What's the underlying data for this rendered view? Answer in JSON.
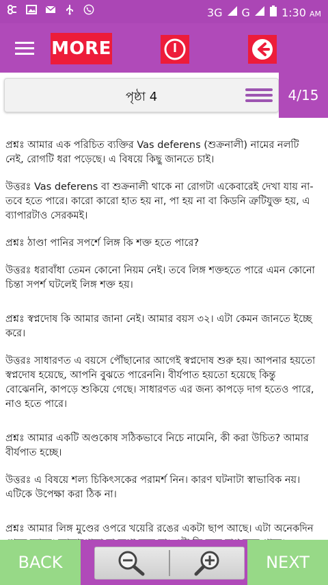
{
  "status_bar": {
    "network": "3G",
    "time": "1:30",
    "ampm": "AM"
  },
  "app_bar": {
    "more_label": "MORE"
  },
  "page_bar": {
    "title": "পৃষ্ঠা 4",
    "count": "4/15"
  },
  "content": {
    "paragraphs": [
      "প্রশ্নঃ আমার এক পরিচিত ব্যক্তির Vas deferens (শুক্রনালী) নামের নলটি নেই, রোগটি ধরা পড়েছে। এ বিষয়ে কিছু জানতে চাই।",
      "উত্তরঃ Vas deferens বা শুক্রনালী থাকে না রোগটা একেবারেই দেখা যায় না- তবে হতে পারে। কারো কারো হাত হয় না, পা হয় না বা কিডনি ত্রুটিযুক্ত হয়, এ ব্যাপারটাও সেরকমই।",
      "প্রশ্নঃ ঠাণ্ডা পানির সপর্শে লিঙ্গ কি শক্ত হতে পারে?",
      "উত্তরঃ ধরাবাঁধা তেমন কোনো নিয়ম নেই। তবে লিঙ্গ শক্তহতে পারে এমন কোনো চিন্তা সপর্শ ঘটলেই লিঙ্গ শক্ত হয়।",
      "প্রশ্নঃ স্বপ্নদোষ কি আমার জানা নেই। আমার বয়স ৩২। এটা কেমন জানতে ইচ্ছে করে।",
      "উত্তরঃ সাধারণত এ বয়সে পৌঁছানোর আগেই স্বপ্নদোষ শুরু হয়। আপনার হয়তো স্বপ্নদোষ হয়েছে, আপনি বুঝতে পারেননি। বীর্যপাত হয়তো হয়েছে কিন্তু বোঝেননি, কাপড়ে শুকিয়ে গেছে। সাধারণত এর জন্য কাপড়ে দাগ হতেও পারে, নাও হতে পারে।",
      "প্রশ্নঃ আমার একটি অণ্ডকোষ সঠিকভাবে নিচে নামেনি, কী করা উচিত? আমার বীর্যপাত হচ্ছে।",
      "উত্তরঃ এ বিষয়ে শল্য চিকিৎসকের পরামর্শ নিন। কারণ ঘটনাটা স্বাভাবিক নয়। এটিকে উপেক্ষা করা ঠিক না।",
      "প্রশ্নঃ আমার লিঙ্গ মুণ্ডের ওপরে খয়েরি রঙের একটা ছাপ আছে। এটা অনেকদিন থেকে আছে। জ্বালাপোড়া বা ব্যথা করে না। এটা কি জন্ম দাগ হতে পারে।"
    ]
  },
  "bottom_bar": {
    "back_label": "BACK",
    "next_label": "NEXT"
  },
  "colors": {
    "primary": "#b04ab9",
    "accent_red": "#ed1c3a",
    "nav_green": "#97d987"
  }
}
